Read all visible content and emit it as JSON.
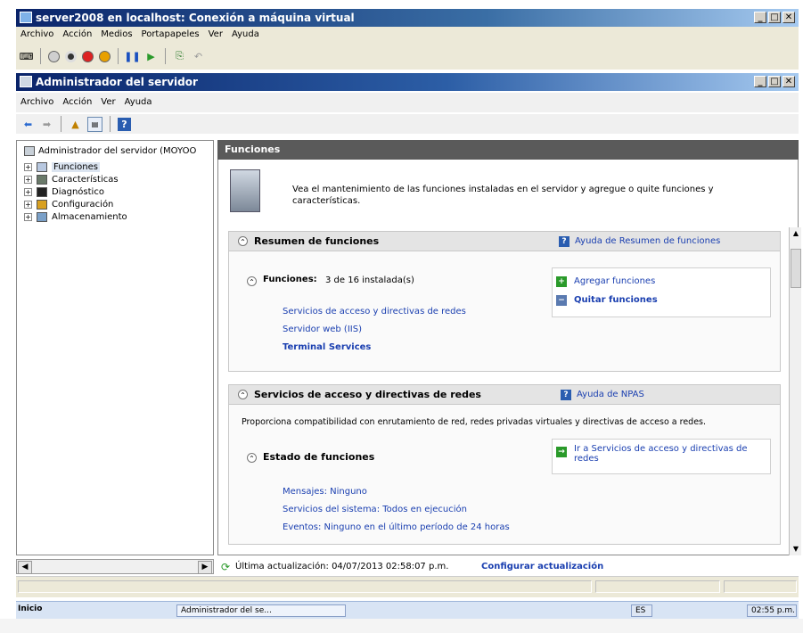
{
  "vm_window": {
    "title": "server2008 en localhost: Conexión a máquina virtual",
    "menu": [
      "Archivo",
      "Acción",
      "Medios",
      "Portapapeles",
      "Ver",
      "Ayuda"
    ],
    "buttons": [
      "_",
      "□",
      "✕"
    ]
  },
  "server_manager": {
    "title": "Administrador del servidor",
    "menu": [
      "Archivo",
      "Acción",
      "Ver",
      "Ayuda"
    ],
    "buttons": [
      "_",
      "□",
      "✕"
    ]
  },
  "tree": {
    "root": "Administrador del servidor (MOYOO",
    "items": [
      {
        "label": "Funciones",
        "selected": true
      },
      {
        "label": "Características"
      },
      {
        "label": "Diagnóstico"
      },
      {
        "label": "Configuración"
      },
      {
        "label": "Almacenamiento"
      }
    ]
  },
  "content": {
    "header": "Funciones",
    "intro": "Vea el mantenimiento de las funciones instaladas en el servidor y agregue o quite funciones y características.",
    "summary": {
      "title": "Resumen de funciones",
      "help": "Ayuda de Resumen de funciones",
      "roles_label": "Funciones:",
      "roles_count": "3 de 16 instalada(s)",
      "roles": [
        "Servicios de acceso y directivas de redes",
        "Servidor web (IIS)",
        "Terminal Services"
      ],
      "actions": [
        "Agregar funciones",
        "Quitar funciones"
      ]
    },
    "npas": {
      "title": "Servicios de acceso y directivas de redes",
      "help": "Ayuda de NPAS",
      "description": "Proporciona compatibilidad con enrutamiento de red, redes privadas virtuales y directivas de acceso a redes.",
      "status_title": "Estado de funciones",
      "goto": "Ir a Servicios de acceso y directivas de redes",
      "messages": "Mensajes: Ninguno",
      "services": "Servicios del sistema: Todos en ejecución",
      "events": "Eventos: Ninguno en el último período de 24 horas"
    },
    "footer": {
      "last_update": "Última actualización: 04/07/2013 02:58:07 p.m.",
      "configure": "Configurar actualización"
    }
  },
  "taskbar": {
    "start": "Inicio",
    "window": "Administrador del se...",
    "lang": "ES",
    "clock": "02:55 p.m."
  },
  "colors": {
    "titlebar": "#0a246a",
    "content_header": "#5a5a5a",
    "link": "#1a3fb0"
  }
}
